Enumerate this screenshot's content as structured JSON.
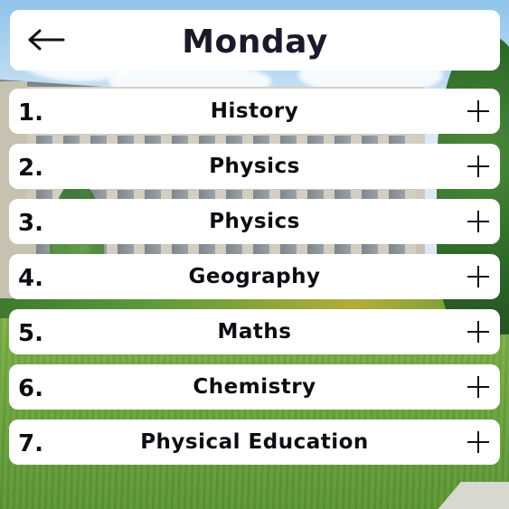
{
  "header": {
    "title": "Monday",
    "back_icon": "arrow-left-icon"
  },
  "lessons": [
    {
      "number": "1.",
      "subject": "History",
      "action_icon": "plus-icon"
    },
    {
      "number": "2.",
      "subject": "Physics",
      "action_icon": "plus-icon"
    },
    {
      "number": "3.",
      "subject": "Physics",
      "action_icon": "plus-icon"
    },
    {
      "number": "4.",
      "subject": "Geography",
      "action_icon": "plus-icon"
    },
    {
      "number": "5.",
      "subject": "Maths",
      "action_icon": "plus-icon"
    },
    {
      "number": "6.",
      "subject": "Chemistry",
      "action_icon": "plus-icon"
    },
    {
      "number": "7.",
      "subject": "Physical Education",
      "action_icon": "plus-icon"
    }
  ],
  "colors": {
    "card_background": "#ffffff",
    "title_text": "#1a1a2b",
    "row_text": "#0c0c12"
  }
}
